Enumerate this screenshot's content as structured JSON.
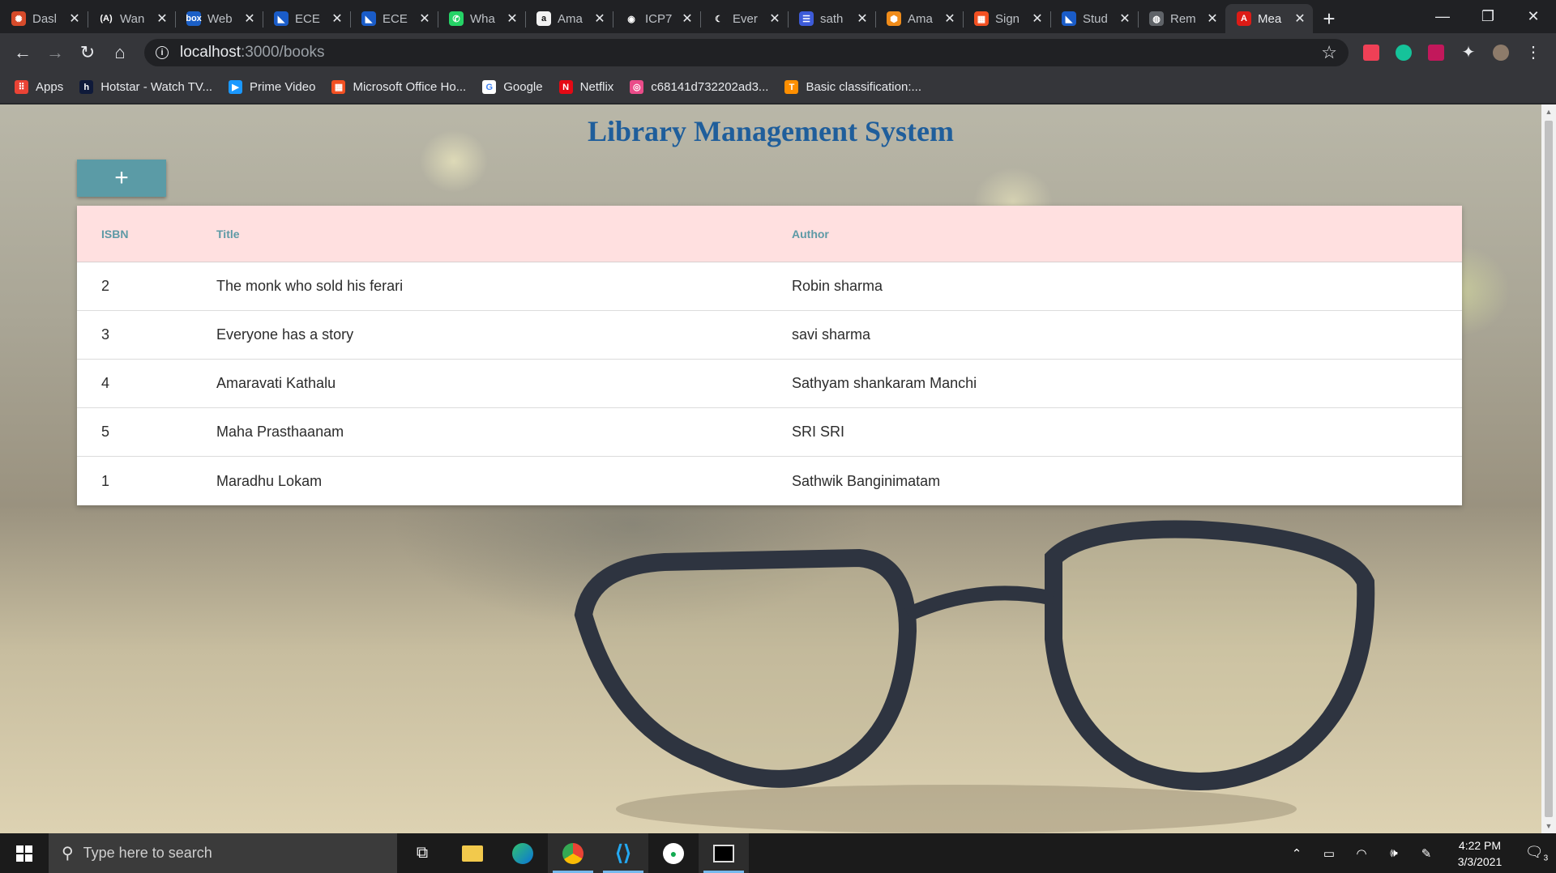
{
  "browser": {
    "tabs": [
      {
        "title": "Dasl",
        "fav_color": "#d64b2b",
        "fav_glyph": "✺"
      },
      {
        "title": "Wan",
        "fav_color": "#202124",
        "fav_glyph": "(A)"
      },
      {
        "title": "Web",
        "fav_color": "#1b5fc6",
        "fav_glyph": "box"
      },
      {
        "title": "ECE",
        "fav_color": "#1a5cc8",
        "fav_glyph": "◣"
      },
      {
        "title": "ECE",
        "fav_color": "#1a5cc8",
        "fav_glyph": "◣"
      },
      {
        "title": "Wha",
        "fav_color": "#25d366",
        "fav_glyph": "✆"
      },
      {
        "title": "Ama",
        "fav_color": "#f2f2f2",
        "fav_glyph": "a"
      },
      {
        "title": "ICP7",
        "fav_color": "#202124",
        "fav_glyph": "◉"
      },
      {
        "title": "Ever",
        "fav_color": "#202124",
        "fav_glyph": "☾"
      },
      {
        "title": "sath",
        "fav_color": "#3d5bd9",
        "fav_glyph": "☰"
      },
      {
        "title": "Ama",
        "fav_color": "#f08c1a",
        "fav_glyph": "⬢"
      },
      {
        "title": "Sign",
        "fav_color": "#f25022",
        "fav_glyph": "▦"
      },
      {
        "title": "Stud",
        "fav_color": "#1a5cc8",
        "fav_glyph": "◣"
      },
      {
        "title": "Rem",
        "fav_color": "#5f6368",
        "fav_glyph": "◍"
      },
      {
        "title": "Mea",
        "fav_color": "#dd1b16",
        "fav_glyph": "A"
      }
    ],
    "url_host": "localhost",
    "url_path": ":3000/books",
    "bookmarks": [
      {
        "label": "Apps",
        "color": "#ea4335",
        "glyph": "⠿"
      },
      {
        "label": "Hotstar - Watch TV...",
        "color": "#0f1a3a",
        "glyph": "h"
      },
      {
        "label": "Prime Video",
        "color": "#1a98ff",
        "glyph": "▶"
      },
      {
        "label": "Microsoft Office Ho...",
        "color": "#f25022",
        "glyph": "▦"
      },
      {
        "label": "Google",
        "color": "#ffffff",
        "glyph": "G"
      },
      {
        "label": "Netflix",
        "color": "#e50914",
        "glyph": "N"
      },
      {
        "label": "c68141d732202ad3...",
        "color": "#ea4c89",
        "glyph": "◎"
      },
      {
        "label": "Basic classification:...",
        "color": "#ff8f00",
        "glyph": "T"
      }
    ]
  },
  "page": {
    "title": "Library Management System",
    "add_label": "+",
    "columns": [
      "ISBN",
      "Title",
      "Author"
    ],
    "rows": [
      {
        "isbn": "2",
        "title": "The monk who sold his ferari",
        "author": "Robin sharma"
      },
      {
        "isbn": "3",
        "title": "Everyone has a story",
        "author": "savi sharma"
      },
      {
        "isbn": "4",
        "title": "Amaravati Kathalu",
        "author": "Sathyam shankaram Manchi"
      },
      {
        "isbn": "5",
        "title": "Maha Prasthaanam",
        "author": "SRI SRI"
      },
      {
        "isbn": "1",
        "title": "Maradhu Lokam",
        "author": "Sathwik Banginimatam"
      }
    ]
  },
  "taskbar": {
    "search_placeholder": "Type here to search",
    "time": "4:22 PM",
    "date": "3/3/2021",
    "notification_count": "3"
  }
}
